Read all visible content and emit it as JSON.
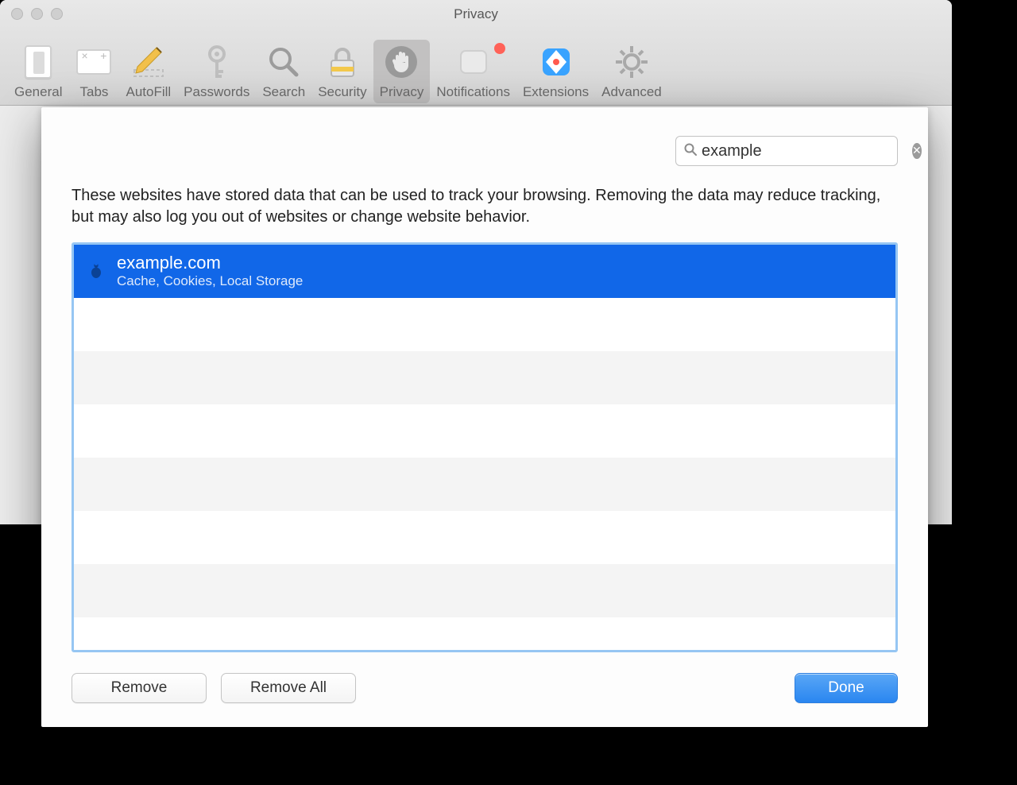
{
  "window": {
    "title": "Privacy"
  },
  "toolbar": {
    "items": [
      {
        "label": "General"
      },
      {
        "label": "Tabs"
      },
      {
        "label": "AutoFill"
      },
      {
        "label": "Passwords"
      },
      {
        "label": "Search"
      },
      {
        "label": "Security"
      },
      {
        "label": "Privacy"
      },
      {
        "label": "Notifications"
      },
      {
        "label": "Extensions"
      },
      {
        "label": "Advanced"
      }
    ],
    "selected": "Privacy"
  },
  "sheet": {
    "search": {
      "value": "example"
    },
    "description": "These websites have stored data that can be used to track your browsing. Removing the data may reduce tracking, but may also log you out of websites or change website behavior.",
    "rows": [
      {
        "domain": "example.com",
        "detail": "Cache, Cookies, Local Storage",
        "selected": true
      }
    ],
    "buttons": {
      "remove": "Remove",
      "remove_all": "Remove All",
      "done": "Done"
    }
  }
}
